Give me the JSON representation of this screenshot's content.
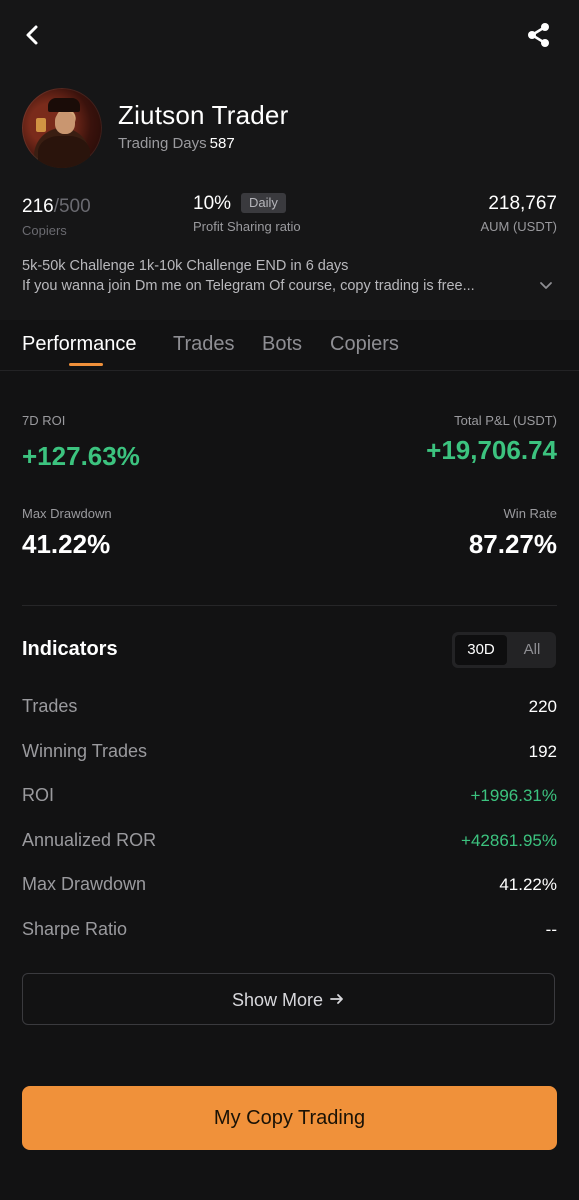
{
  "header": {
    "back_icon": "chevron-left-icon",
    "share_icon": "share-icon"
  },
  "profile": {
    "name": "Ziutson Trader",
    "trading_days_label": "Trading Days",
    "trading_days": "587"
  },
  "stats": {
    "copiers_current": "216",
    "copiers_max": "/500",
    "copiers_label": "Copiers",
    "profit_share": "10%",
    "profit_share_badge": "Daily",
    "profit_share_label": "Profit Sharing ratio",
    "aum": "218,767",
    "aum_label": "AUM (USDT)"
  },
  "bio": {
    "line1": "5k-50k Challenge  1k-10k Challenge  END in 6 days",
    "line2": "If you wanna join Dm me on Telegram Of course, copy trading is free..."
  },
  "tabs": [
    {
      "label": "Performance",
      "active": true
    },
    {
      "label": "Trades",
      "active": false
    },
    {
      "label": "Bots",
      "active": false
    },
    {
      "label": "Copiers",
      "active": false
    }
  ],
  "performance": {
    "roi_label": "7D ROI",
    "roi_value": "+127.63%",
    "pnl_label": "Total P&L (USDT)",
    "pnl_value": "+19,706.74",
    "drawdown_label": "Max Drawdown",
    "drawdown_value": "41.22%",
    "winrate_label": "Win Rate",
    "winrate_value": "87.27%"
  },
  "indicators": {
    "title": "Indicators",
    "periods": [
      "30D",
      "All"
    ],
    "selected_period": "30D",
    "rows": [
      {
        "label": "Trades",
        "value": "220",
        "positive": false
      },
      {
        "label": "Winning Trades",
        "value": "192",
        "positive": false
      },
      {
        "label": "ROI",
        "value": "+1996.31%",
        "positive": true
      },
      {
        "label": "Annualized ROR",
        "value": "+42861.95%",
        "positive": true
      },
      {
        "label": "Max Drawdown",
        "value": "41.22%",
        "positive": false
      },
      {
        "label": "Sharpe Ratio",
        "value": "--",
        "positive": false
      }
    ]
  },
  "actions": {
    "show_more": "Show More",
    "copy_trading": "My Copy Trading"
  },
  "colors": {
    "accent": "#f0913a",
    "positive": "#3cc37f",
    "background": "#0b0b0c"
  }
}
